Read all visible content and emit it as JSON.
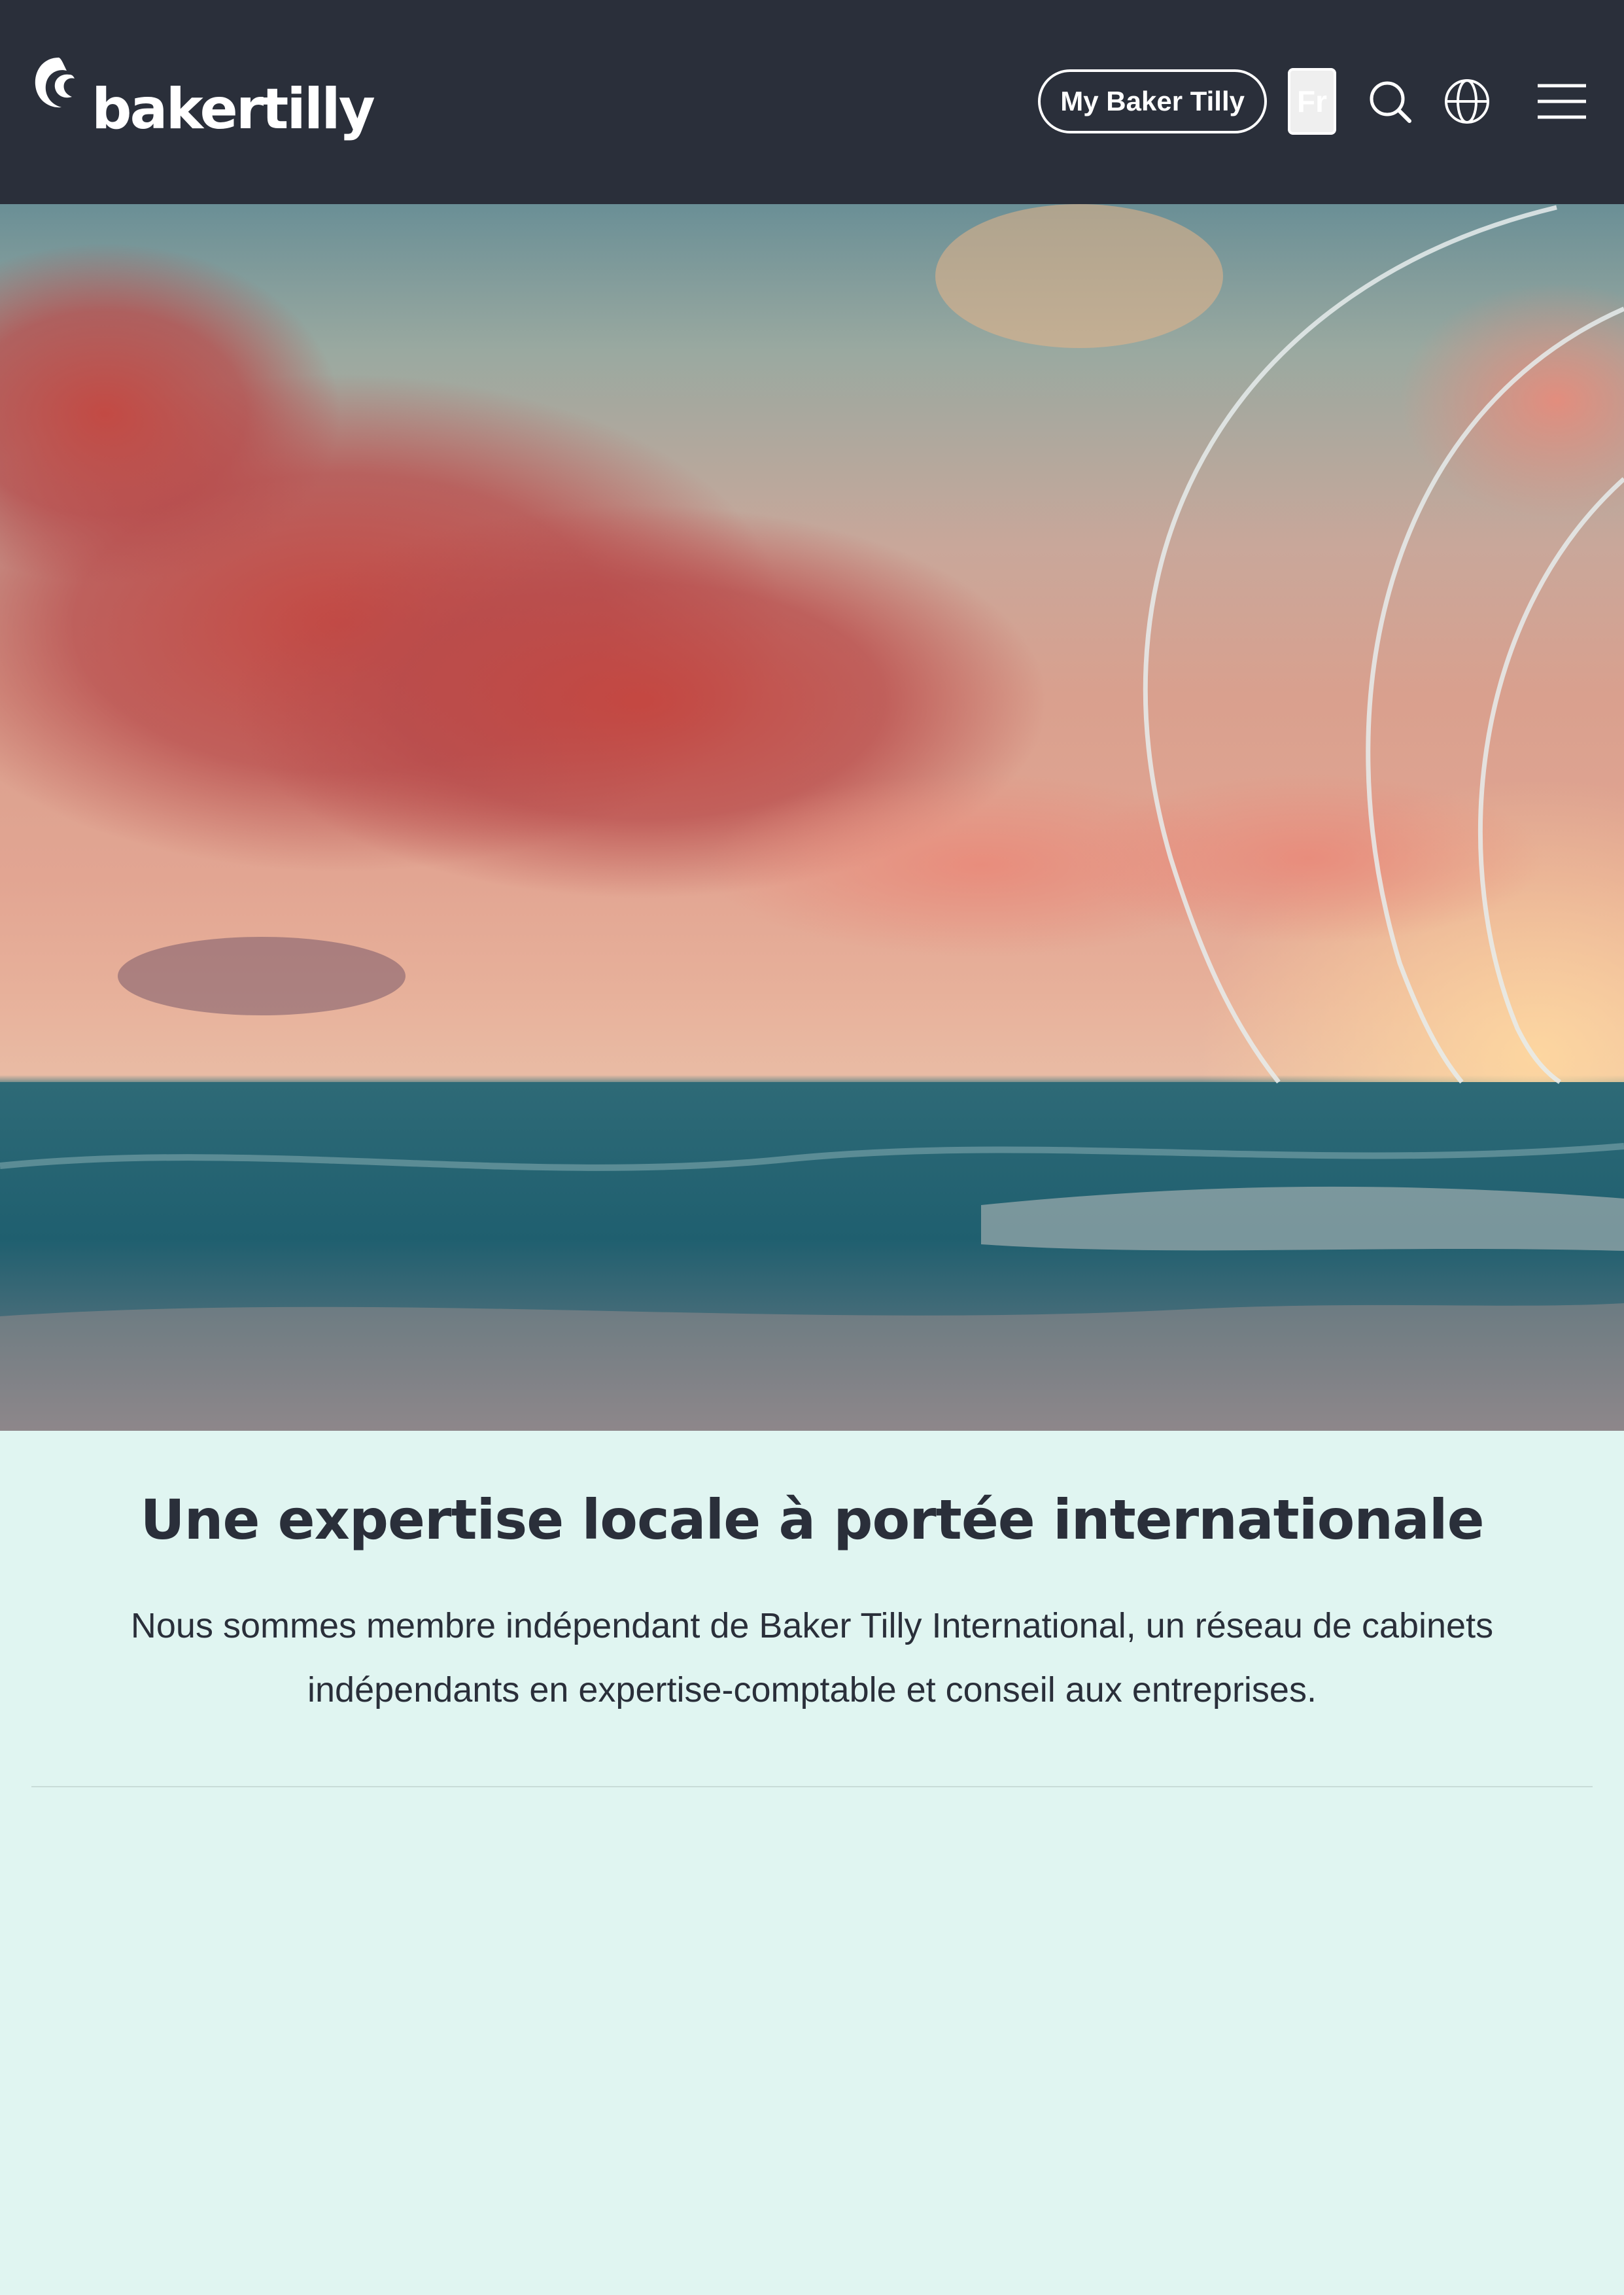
{
  "header": {
    "logo_text": "bakertilly",
    "my_account_label": "My Baker Tilly",
    "language_label": "Fr",
    "icons": {
      "search": "search-icon",
      "language": "globe-icon",
      "menu": "hamburger-menu-icon"
    }
  },
  "intro": {
    "title": "Une expertise locale à portée internationale",
    "text": "Nous sommes membre indépendant de Baker Tilly International, un réseau de cabinets indépendants en expertise-comptable et conseil aux entreprises."
  },
  "colors": {
    "header_bg": "#2a2f3a",
    "page_bg": "#e0f5f1",
    "text": "#2a2f3a"
  }
}
